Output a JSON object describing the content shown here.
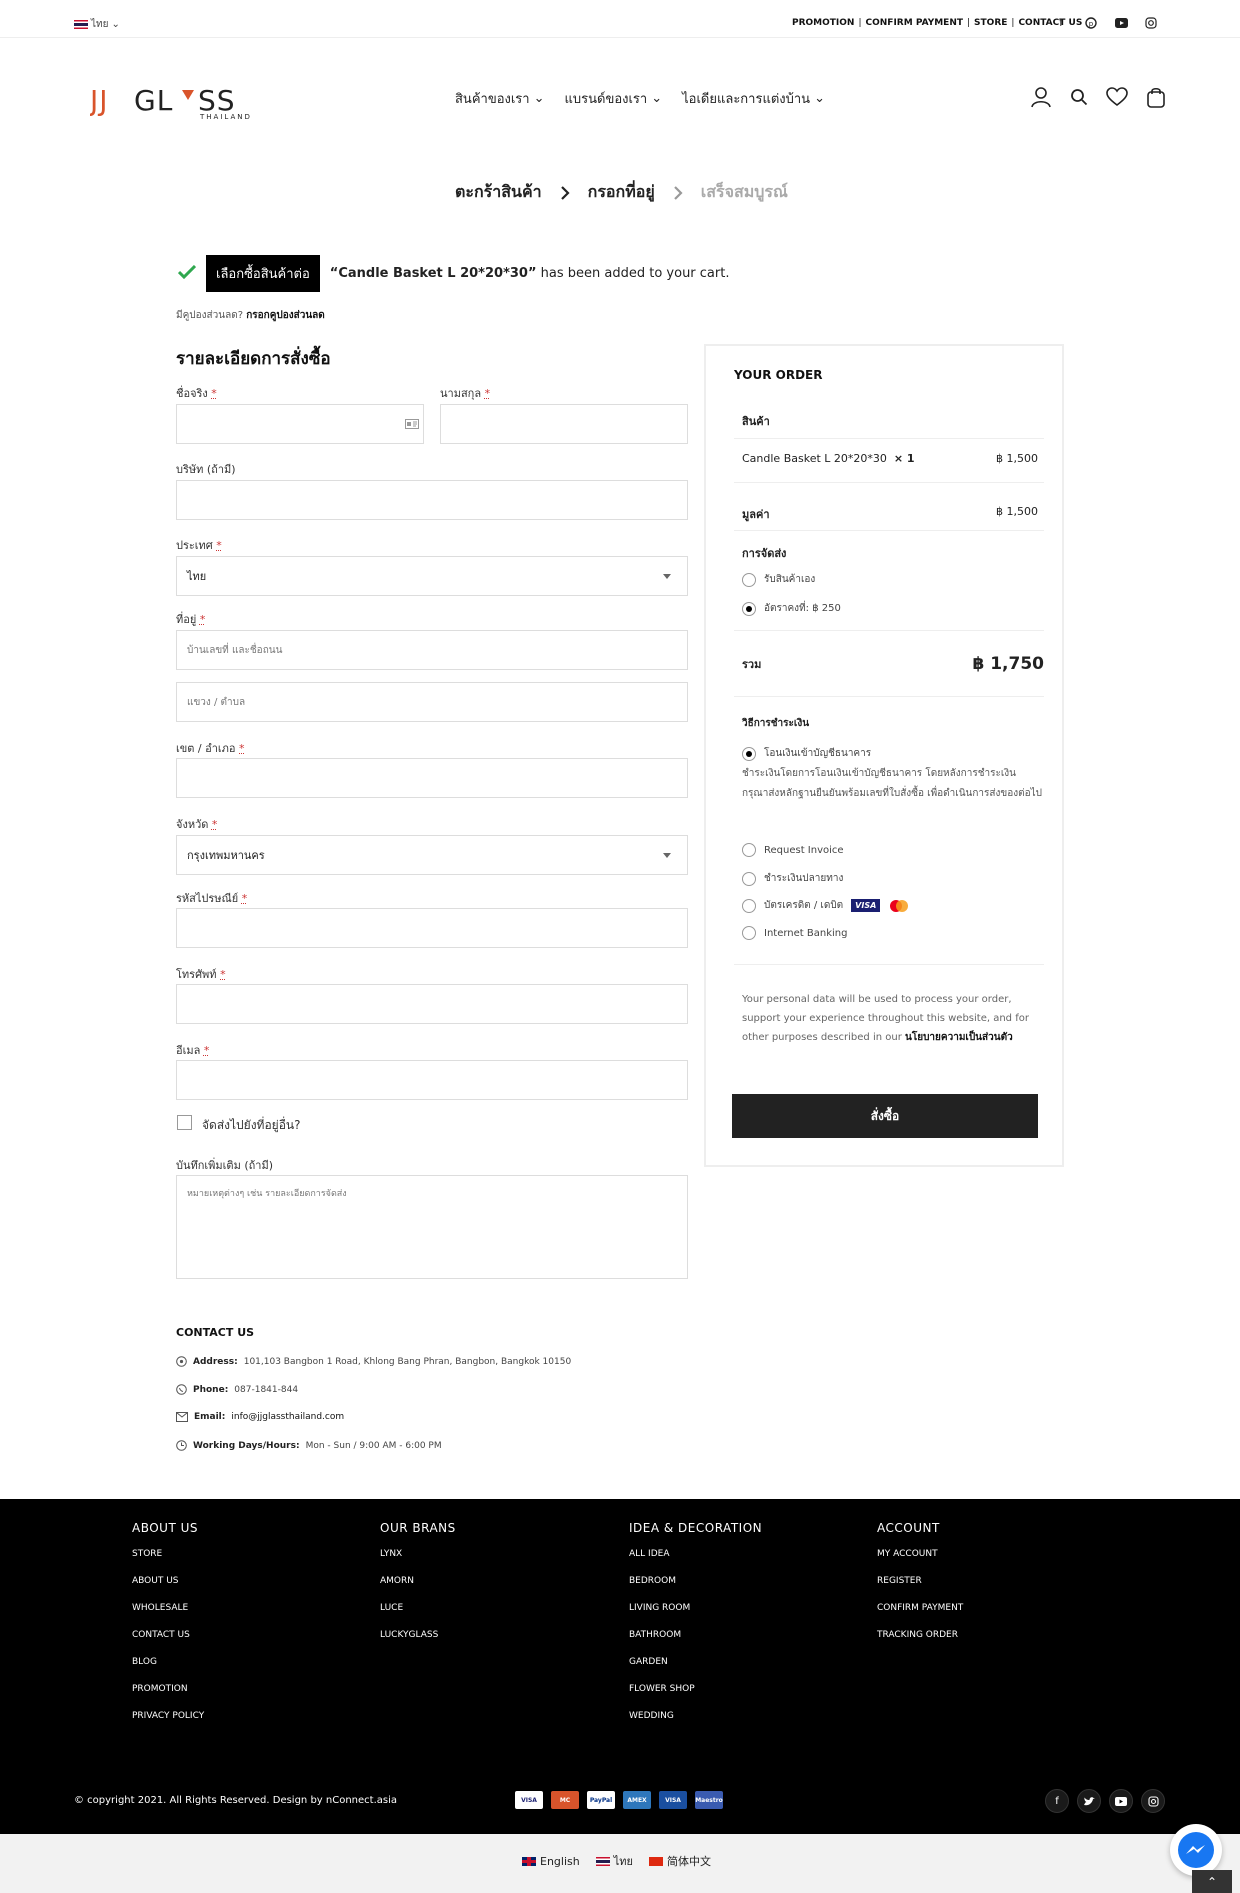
{
  "topbar": {
    "language": "ไทย",
    "links": [
      "PROMOTION",
      "CONFIRM PAYMENT",
      "STORE",
      "CONTACT US"
    ]
  },
  "header": {
    "logo_text": "JJGLASS",
    "logo_sub": "THAILAND",
    "nav": [
      "สินค้าของเรา",
      "แบรนด์ของเรา",
      "ไอเดียและการแต่งบ้าน"
    ]
  },
  "steps": {
    "cart": "ตะกร้าสินค้า",
    "address": "กรอกที่อยู่",
    "complete": "เสร็จสมบูรณ์"
  },
  "notice": {
    "continue_label": "เลือกซื้อสินค้าต่อ",
    "product": "“Candle Basket L 20*20*30”",
    "message": "has been added to your cart."
  },
  "coupon": {
    "question": "มีคูปองส่วนลด?",
    "link": "กรอกคูปองส่วนลด"
  },
  "billing": {
    "title": "รายละเอียดการสั่งซื้อ",
    "first_name": "ชื่อจริง",
    "last_name": "นามสกุล",
    "company": "บริษัท (ถ้ามี)",
    "country": "ประเทศ",
    "country_value": "ไทย",
    "address": "ที่อยู่",
    "address_placeholder": "บ้านเลขที่ และชื่อถนน",
    "address2_placeholder": "แขวง / ตำบล",
    "district": "เขต / อำเภอ",
    "province": "จังหวัด",
    "province_value": "กรุงเทพมหานคร",
    "postcode": "รหัสไปรษณีย์",
    "phone": "โทรศัพท์",
    "email": "อีเมล",
    "ship_different": "จัดส่งไปยังที่อยู่อื่น?",
    "notes": "บันทึกเพิ่มเติม (ถ้ามี)",
    "notes_placeholder": "หมายเหตุต่างๆ เช่น รายละเอียดการจัดส่ง",
    "required": "*"
  },
  "contact": {
    "title": "CONTACT US",
    "address_label": "Address:",
    "address": "101,103 Bangbon 1 Road, Khlong Bang Phran, Bangbon, Bangkok 10150",
    "phone_label": "Phone:",
    "phone": "087-1841-844",
    "email_label": "Email:",
    "email": "info@jjglassthailand.com",
    "hours_label": "Working Days/Hours:",
    "hours": "Mon - Sun / 9:00 AM - 6:00 PM"
  },
  "order": {
    "title": "YOUR ORDER",
    "product_header": "สินค้า",
    "item_name": "Candle Basket L 20*20*30",
    "item_qty": "× 1",
    "item_price": "฿ 1,500",
    "subtotal_label": "มูลค่า",
    "subtotal": "฿ 1,500",
    "shipping_label": "การจัดส่ง",
    "ship_pickup": "รับสินค้าเอง",
    "ship_flat": "อัตราคงที่: ฿ 250",
    "total_label": "รวม",
    "total": "฿ 1,750",
    "payment_label": "วิธีการชำระเงิน",
    "pay_bank": "โอนเงินเข้าบัญชีธนาคาร",
    "pay_bank_desc": "ชำระเงินโดยการโอนเงินเข้าบัญชีธนาคาร โดยหลังการชำระเงิน กรุณาส่งหลักฐานยืนยันพร้อมเลขที่ใบสั่งซื้อ เพื่อดำเนินการส่งของต่อไป",
    "pay_invoice": "Request Invoice",
    "pay_cod": "ชำระเงินปลายทาง",
    "pay_card": "บัตรเครดิต / เดบิต",
    "pay_internet": "Internet Banking",
    "privacy_text": "Your personal data will be used to process your order, support your experience throughout this website, and for other purposes described in our",
    "privacy_link": "นโยบายความเป็นส่วนตัว",
    "place_order": "สั่งซื้อ"
  },
  "footer": {
    "cols": [
      {
        "title": "ABOUT US",
        "items": [
          "STORE",
          "ABOUT US",
          "WHOLESALE",
          "CONTACT US",
          "BLOG",
          "PROMOTION",
          "PRIVACY POLICY"
        ]
      },
      {
        "title": "OUR BRANS",
        "items": [
          "LYNX",
          "AMORN",
          "LUCE",
          "LUCKYGLASS"
        ]
      },
      {
        "title": "IDEA & DECORATION",
        "items": [
          "ALL IDEA",
          "BEDROOM",
          "LIVING ROOM",
          "BATHROOM",
          "GARDEN",
          "FLOWER SHOP",
          "WEDDING"
        ]
      },
      {
        "title": "ACCOUNT",
        "items": [
          "MY ACCOUNT",
          "REGISTER",
          "CONFIRM PAYMENT",
          "TRACKING ORDER"
        ]
      }
    ],
    "copyright": "© copyright 2021. All Rights Reserved. Design by nConnect.asia",
    "cards": [
      "VISA",
      "MC",
      "PayPal",
      "AMEX",
      "VISA",
      "Maestro"
    ]
  },
  "langs": [
    "English",
    "ไทย",
    "简体中文"
  ],
  "colors": {
    "logo_accent": "#d9542b",
    "footer_bg": "#000000",
    "button_dark": "#222222"
  }
}
